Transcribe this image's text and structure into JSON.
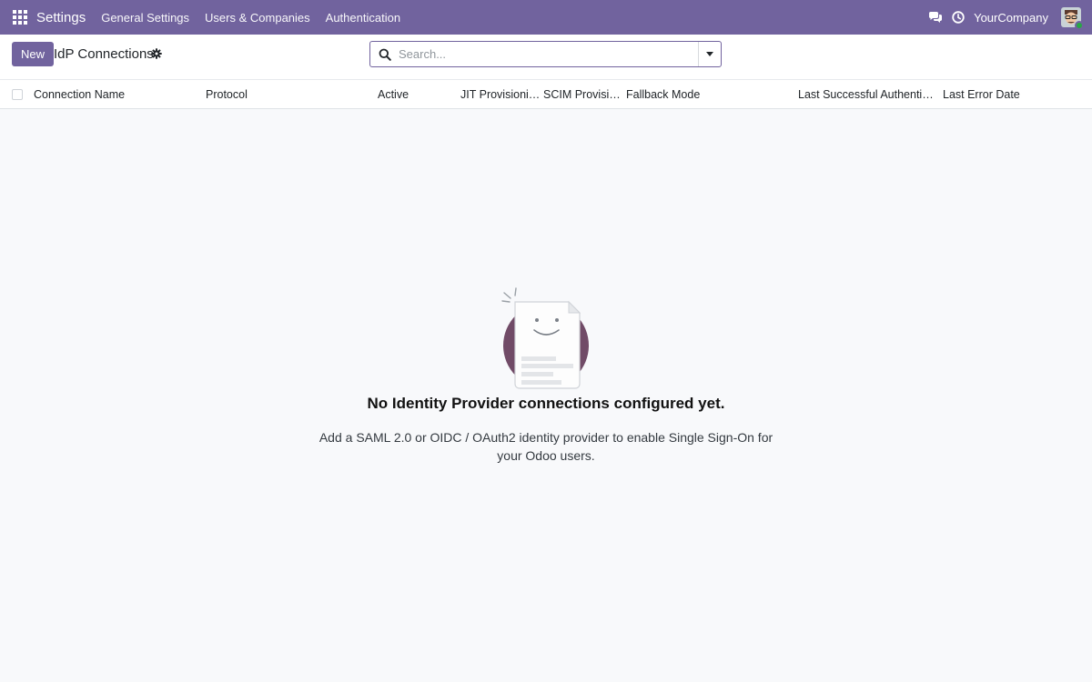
{
  "navbar": {
    "brand": "Settings",
    "menu": [
      "General Settings",
      "Users & Companies",
      "Authentication"
    ],
    "company": "YourCompany"
  },
  "control": {
    "new_label": "New",
    "title": "IdP Connections",
    "search_placeholder": "Search..."
  },
  "table": {
    "columns": [
      "Connection Name",
      "Protocol",
      "Active",
      "JIT Provisioning",
      "SCIM Provisi…",
      "Fallback Mode",
      "Last Successful Authentic…",
      "Last Error Date"
    ]
  },
  "empty_state": {
    "title": "No Identity Provider connections configured yet.",
    "text": "Add a SAML 2.0 or OIDC / OAuth2 identity provider to enable Single Sign-On for your Odoo users."
  },
  "colors": {
    "brand": "#71639e",
    "illustration_circle": "#714b67"
  }
}
